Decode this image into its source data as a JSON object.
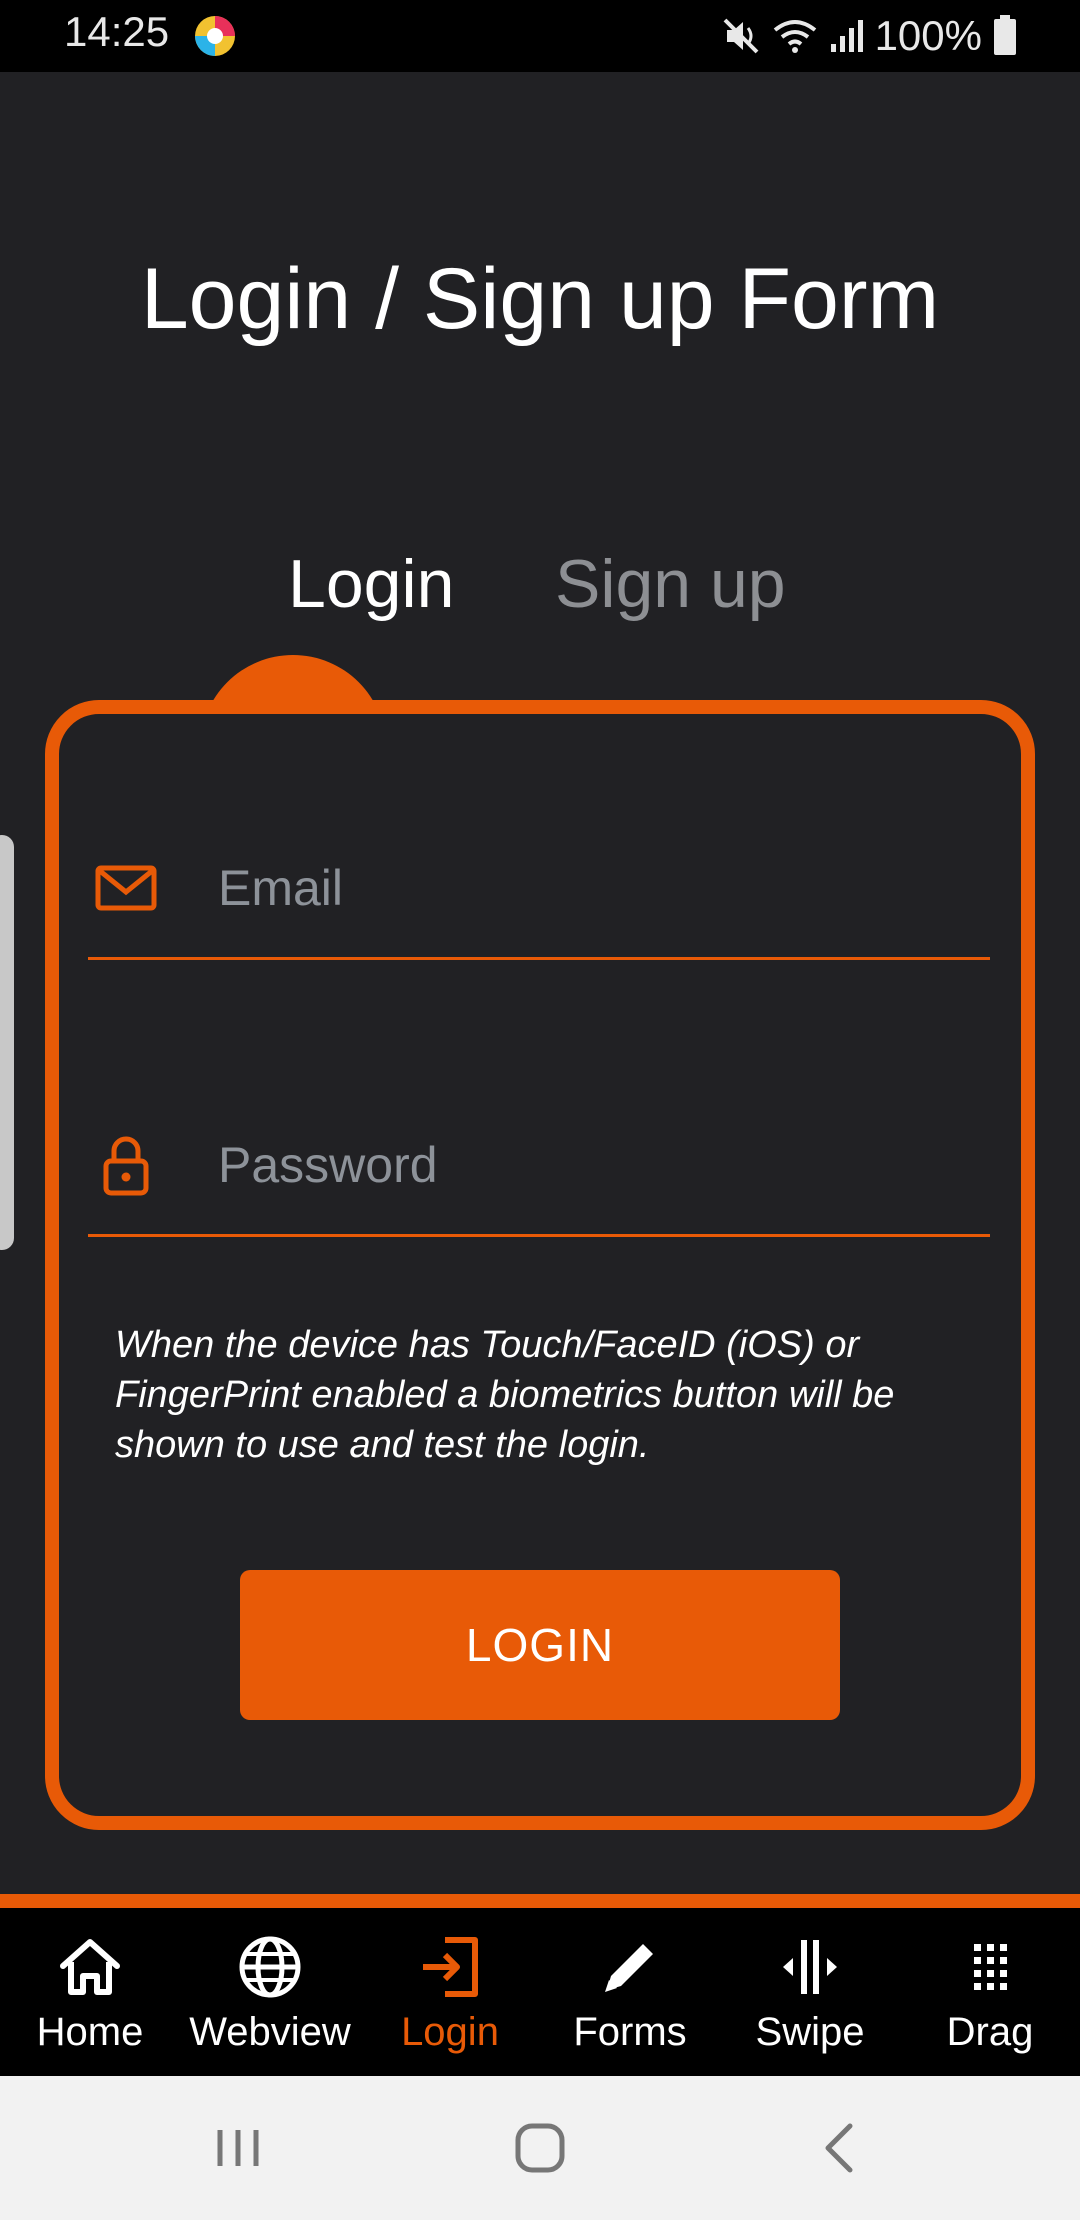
{
  "status_bar": {
    "time": "14:25",
    "battery_text": "100%",
    "icons": [
      "mute-icon",
      "wifi-icon",
      "signal-icon",
      "battery-icon"
    ]
  },
  "page": {
    "title": "Login / Sign up Form"
  },
  "tabs": [
    {
      "label": "Login",
      "active": true
    },
    {
      "label": "Sign up",
      "active": false
    }
  ],
  "form": {
    "email_placeholder": "Email",
    "email_value": "",
    "password_placeholder": "Password",
    "password_value": "",
    "biometrics_note": "When the device has Touch/FaceID (iOS) or FingerPrint enabled a biometrics button will be shown to use and test the login.",
    "login_button": "LOGIN"
  },
  "bottom_tabs": [
    {
      "label": "Home",
      "icon": "home-icon",
      "active": false
    },
    {
      "label": "Webview",
      "icon": "globe-icon",
      "active": false
    },
    {
      "label": "Login",
      "icon": "login-icon",
      "active": true
    },
    {
      "label": "Forms",
      "icon": "pencil-icon",
      "active": false
    },
    {
      "label": "Swipe",
      "icon": "swipe-icon",
      "active": false
    },
    {
      "label": "Drag",
      "icon": "grid-icon",
      "active": false
    }
  ],
  "colors": {
    "accent": "#e85a07",
    "background": "#212124",
    "muted_text": "#8d8f93"
  }
}
